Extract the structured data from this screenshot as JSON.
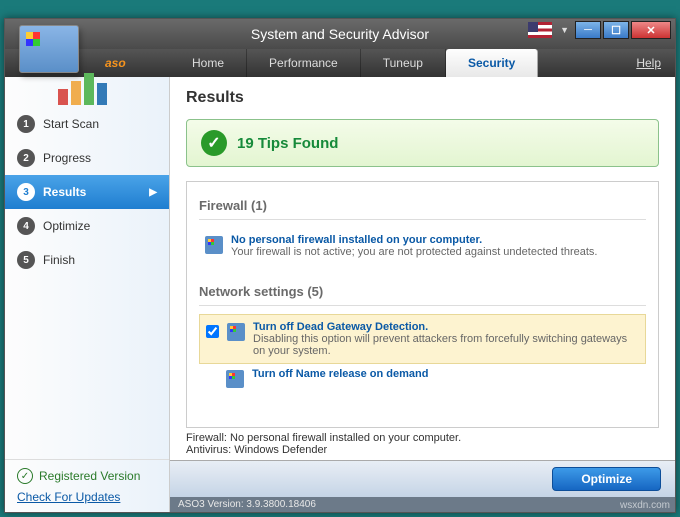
{
  "titlebar": {
    "title": "System and Security Advisor"
  },
  "brand": "aso",
  "menu": {
    "home": "Home",
    "performance": "Performance",
    "tuneup": "Tuneup",
    "security": "Security",
    "help": "Help"
  },
  "sidebar": {
    "steps": [
      {
        "num": "1",
        "label": "Start Scan"
      },
      {
        "num": "2",
        "label": "Progress"
      },
      {
        "num": "3",
        "label": "Results"
      },
      {
        "num": "4",
        "label": "Optimize"
      },
      {
        "num": "5",
        "label": "Finish"
      }
    ],
    "registered": "Registered Version",
    "check_updates": "Check For Updates"
  },
  "content": {
    "header": "Results",
    "tips_found": "19 Tips Found",
    "sections": {
      "firewall": {
        "title": "Firewall   (1)",
        "items": [
          {
            "title": "No personal firewall installed on your computer.",
            "desc": "Your firewall is not active; you are not protected against undetected threats."
          }
        ]
      },
      "network": {
        "title": "Network settings   (5)",
        "items": [
          {
            "title": "Turn off Dead Gateway Detection.",
            "desc": "Disabling this option will prevent attackers from forcefully switching gateways on your system.",
            "checked": true,
            "highlight": true
          },
          {
            "title": "Turn off Name release on demand",
            "desc": ""
          }
        ]
      }
    },
    "status": {
      "firewall": "Firewall: No personal firewall installed on your computer.",
      "antivirus": "Antivirus: Windows Defender"
    },
    "optimize_btn": "Optimize"
  },
  "version": "ASO3 Version: 3.9.3800.18406",
  "watermark": "wsxdn.com"
}
